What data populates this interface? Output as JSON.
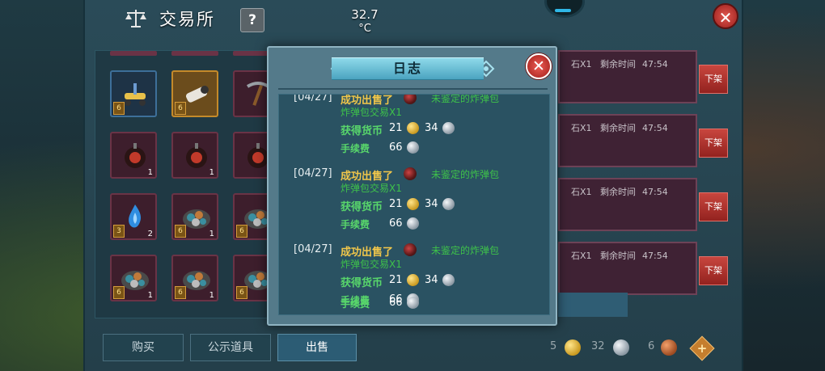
{
  "window": {
    "title": "交易所",
    "help_label": "?",
    "close_label": "✕"
  },
  "status_overlay": {
    "temperature": "32.7",
    "unit": "°C"
  },
  "inventory": {
    "slots": [
      {
        "row": 0,
        "col": 0,
        "count": "",
        "level": "6",
        "border": "blue",
        "icon": "scooter-icon"
      },
      {
        "row": 0,
        "col": 1,
        "count": "",
        "level": "6",
        "border": "orange",
        "icon": "spyglass-icon"
      },
      {
        "row": 0,
        "col": 2,
        "count": "",
        "level": "",
        "border": "red",
        "icon": "pickaxe-icon"
      },
      {
        "row": 1,
        "col": 0,
        "count": "1",
        "level": "",
        "border": "red",
        "icon": "bomb-icon"
      },
      {
        "row": 1,
        "col": 1,
        "count": "1",
        "level": "",
        "border": "red",
        "icon": "bomb-icon"
      },
      {
        "row": 1,
        "col": 2,
        "count": "",
        "level": "",
        "border": "red",
        "icon": "bomb-icon"
      },
      {
        "row": 2,
        "col": 0,
        "count": "2",
        "level": "3",
        "border": "red",
        "icon": "flame-icon"
      },
      {
        "row": 2,
        "col": 1,
        "count": "1",
        "level": "6",
        "border": "red",
        "icon": "ore-plate-icon"
      },
      {
        "row": 2,
        "col": 2,
        "count": "",
        "level": "6",
        "border": "red",
        "icon": "ore-plate-icon"
      },
      {
        "row": 3,
        "col": 0,
        "count": "1",
        "level": "6",
        "border": "red",
        "icon": "ore-plate-icon"
      },
      {
        "row": 3,
        "col": 1,
        "count": "1",
        "level": "6",
        "border": "red",
        "icon": "ore-plate-icon"
      },
      {
        "row": 3,
        "col": 2,
        "count": "",
        "level": "6",
        "border": "red",
        "icon": "ore-plate-icon"
      }
    ]
  },
  "listings": [
    {
      "qty": "石X1",
      "remaining_label": "剩余时间",
      "remaining_time": "47:54",
      "action": "下架"
    },
    {
      "qty": "石X1",
      "remaining_label": "剩余时间",
      "remaining_time": "47:54",
      "action": "下架"
    },
    {
      "qty": "石X1",
      "remaining_label": "剩余时间",
      "remaining_time": "47:54",
      "action": "下架"
    },
    {
      "qty": "石X1",
      "remaining_label": "剩余时间",
      "remaining_time": "47:54",
      "action": "下架"
    }
  ],
  "bottom_tabs": [
    {
      "label": "购买",
      "active": false
    },
    {
      "label": "公示道具",
      "active": false
    },
    {
      "label": "出售",
      "active": true
    }
  ],
  "wallet": {
    "gold": "5",
    "silver": "32",
    "copper": "6",
    "add_label": "+"
  },
  "log_dialog": {
    "title": "日志",
    "close_label": "✕",
    "entries": [
      {
        "date": "[04/27]",
        "status": "成功出售了",
        "item": "未鉴定的炸弹包",
        "item2": "炸弹包交易X1",
        "earn_label": "获得货币",
        "gold": "21",
        "silver": "34",
        "fee_label": "手续费",
        "fee": "66"
      },
      {
        "date": "[04/27]",
        "status": "成功出售了",
        "item": "未鉴定的炸弹包",
        "item2": "炸弹包交易X1",
        "earn_label": "获得货币",
        "gold": "21",
        "silver": "34",
        "fee_label": "手续费",
        "fee": "66"
      },
      {
        "date": "[04/27]",
        "status": "成功出售了",
        "item": "未鉴定的炸弹包",
        "item2": "炸弹包交易X1",
        "earn_label": "获得货币",
        "gold": "21",
        "silver": "34",
        "fee_label": "手续费",
        "fee": "66"
      },
      {
        "date": "",
        "status": "",
        "item": "",
        "item2": "",
        "earn_label": "",
        "gold": "",
        "silver": "",
        "fee_label": "手续费",
        "fee": "66"
      }
    ]
  },
  "colors": {
    "accent_gold": "#f0c64a",
    "item_green": "#3ec24a",
    "close_red": "#c8463e"
  }
}
